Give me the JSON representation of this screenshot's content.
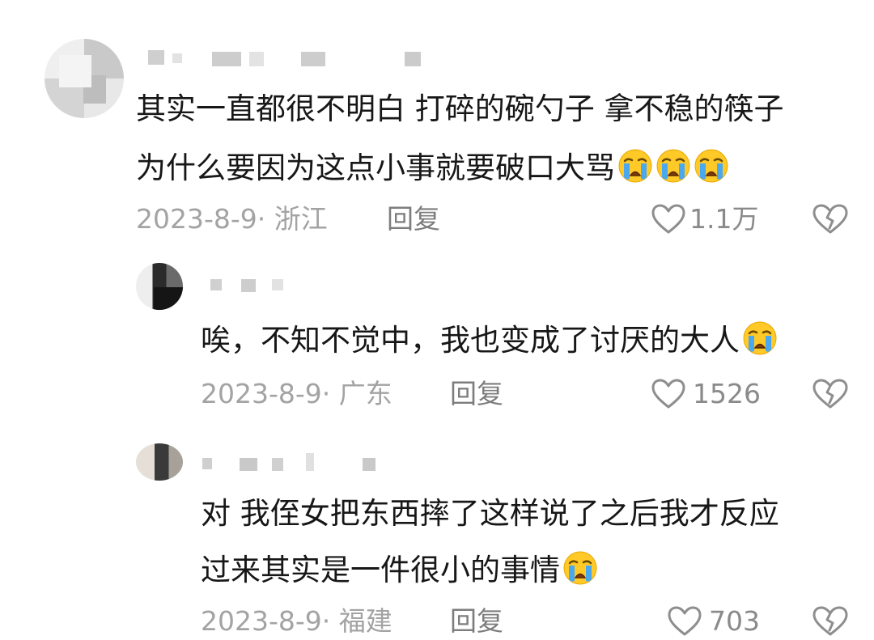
{
  "comments": [
    {
      "text_lines": [
        "其实一直都很不明白 打碎的碗勺子 拿不稳的筷子",
        "为什么要因为这点小事就要破口大骂"
      ],
      "emoji_count": 3,
      "meta": "2023-8-9· 浙江",
      "reply_label": "回复",
      "likes": "1.1万"
    },
    {
      "text_lines": [
        "唉，不知不觉中，我也变成了讨厌的大人"
      ],
      "emoji_count": 1,
      "meta": "2023-8-9· 广东",
      "reply_label": "回复",
      "likes": "1526"
    },
    {
      "text_lines": [
        "对 我侄女把东西摔了这样说了之后我才反应",
        "过来其实是一件很小的事情"
      ],
      "emoji_count": 1,
      "meta": "2023-8-9· 福建",
      "reply_label": "回复",
      "likes": "703"
    }
  ],
  "icons": {
    "like": "heart-outline-icon",
    "dislike": "broken-heart-icon",
    "emoji": "crying-face-emoji"
  }
}
